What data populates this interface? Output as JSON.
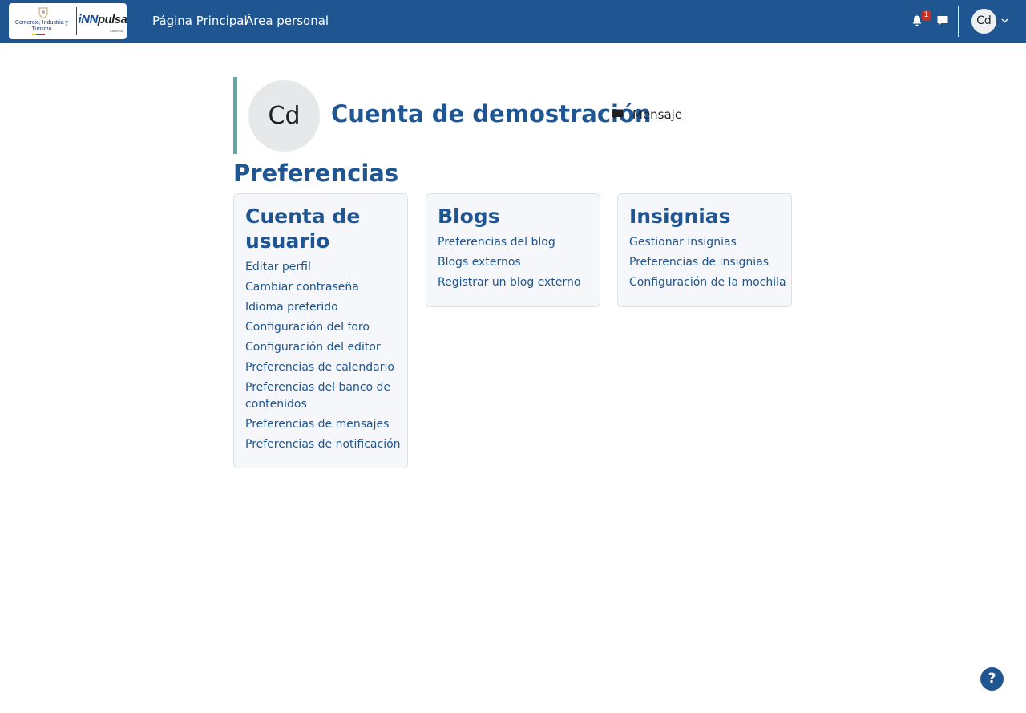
{
  "navbar": {
    "logo_left": "Comercio, Industria y Turismo",
    "logo_right_prefix": "iNN",
    "logo_right_suffix": "pulsa",
    "logo_right_sub": "Colombia",
    "links": [
      "Página Principal",
      "Área personal"
    ],
    "notification_count": "1",
    "user_initials": "Cd",
    "icons": [
      "bell-icon",
      "chat-icon",
      "chevron-down-icon"
    ]
  },
  "header": {
    "avatar_initials": "Cd",
    "user_name": "Cuenta de demostración",
    "message_label": "Mensaje"
  },
  "page_title": "Preferencias",
  "cards": [
    {
      "title": "Cuenta de usuario",
      "links": [
        "Editar perfil",
        "Cambiar contraseña",
        "Idioma preferido",
        "Configuración del foro",
        "Configuración del editor",
        "Preferencias de calendario",
        "Preferencias del banco de contenidos",
        "Preferencias de mensajes",
        "Preferencias de notificación"
      ]
    },
    {
      "title": "Blogs",
      "links": [
        "Preferencias del blog",
        "Blogs externos",
        "Registrar un blog externo"
      ]
    },
    {
      "title": "Insignias",
      "links": [
        "Gestionar insignias",
        "Preferencias de insignias",
        "Configuración de la mochila"
      ]
    }
  ],
  "help_label": "?",
  "colors": {
    "navbar": "#1f5591",
    "accent_bar": "#5fa9a6",
    "link": "#1f5591",
    "badge": "#ca3120"
  }
}
